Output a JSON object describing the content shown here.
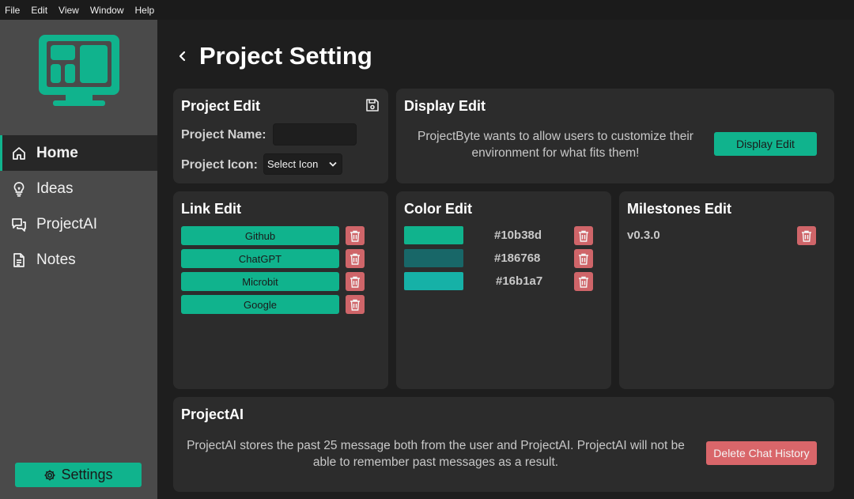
{
  "menubar": [
    "File",
    "Edit",
    "View",
    "Window",
    "Help"
  ],
  "sidebar": {
    "items": [
      {
        "label": "Home",
        "icon": "home-icon",
        "active": true
      },
      {
        "label": "Ideas",
        "icon": "lightbulb-icon",
        "active": false
      },
      {
        "label": "ProjectAI",
        "icon": "chat-icon",
        "active": false
      },
      {
        "label": "Notes",
        "icon": "document-icon",
        "active": false
      }
    ],
    "settings_label": "Settings"
  },
  "page": {
    "title": "Project Setting"
  },
  "project_edit": {
    "title": "Project Edit",
    "name_label": "Project Name:",
    "name_value": "",
    "icon_label": "Project Icon:",
    "icon_select": "Select Icon"
  },
  "display_edit": {
    "title": "Display Edit",
    "description": "ProjectByte wants to allow users to customize their environment for what fits them!",
    "button": "Display Edit"
  },
  "link_edit": {
    "title": "Link Edit",
    "links": [
      "Github",
      "ChatGPT",
      "Microbit",
      "Google"
    ]
  },
  "color_edit": {
    "title": "Color Edit",
    "colors": [
      "#10b38d",
      "#186768",
      "#16b1a7"
    ]
  },
  "milestones_edit": {
    "title": "Milestones Edit",
    "items": [
      "v0.3.0"
    ]
  },
  "projectai": {
    "title": "ProjectAI",
    "description": "ProjectAI stores the past 25 message both from the user and ProjectAI. ProjectAI will not be able to remember past messages as a result.",
    "button": "Delete Chat History"
  },
  "colors": {
    "accent": "#10b38d",
    "danger": "#d9666a",
    "sidebar": "#4a4a4a",
    "card": "#2c2c2c"
  }
}
